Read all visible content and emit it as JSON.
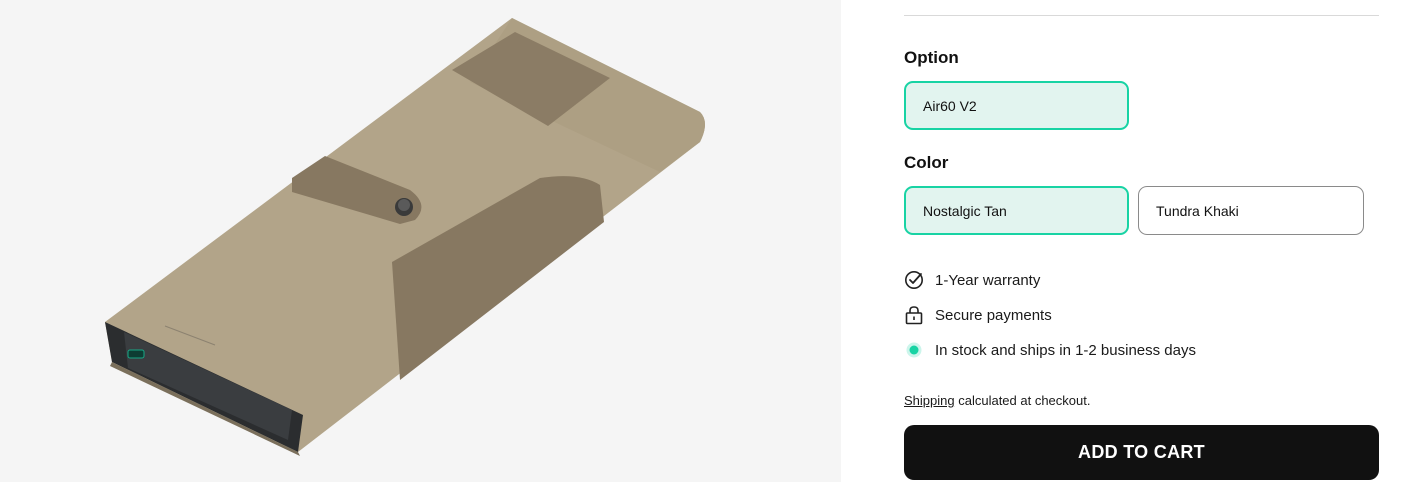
{
  "product_image": {
    "alt": "Keyboard case product image"
  },
  "option": {
    "label": "Option",
    "choices": [
      {
        "label": "Air60 V2",
        "selected": true
      }
    ]
  },
  "color": {
    "label": "Color",
    "choices": [
      {
        "label": "Nostalgic Tan",
        "selected": true
      },
      {
        "label": "Tundra Khaki",
        "selected": false
      }
    ]
  },
  "features": {
    "warranty": {
      "icon": "check-badge-icon",
      "text": "1-Year warranty"
    },
    "payments": {
      "icon": "lock-icon",
      "text": "Secure payments"
    },
    "stock": {
      "icon": "in-stock-dot-icon",
      "text": "In stock and ships in 1-2 business days",
      "color": "#18d3a4"
    }
  },
  "shipping": {
    "link": "Shipping",
    "text": " calculated at checkout."
  },
  "cart_button": {
    "label": "ADD TO CART"
  },
  "colors": {
    "accent": "#18d3a4",
    "selected_bg": "#e2f4ef",
    "button_bg": "#111111"
  }
}
